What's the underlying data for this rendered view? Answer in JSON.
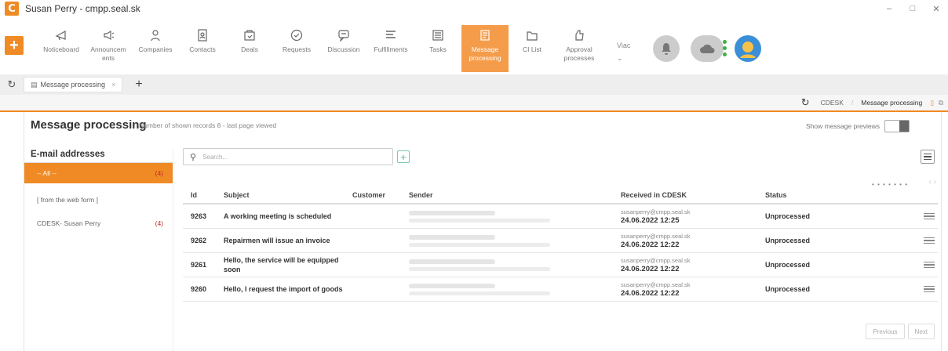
{
  "window": {
    "title": "Susan Perry - cmpp.seal.sk",
    "logo_letter": "C",
    "controls": [
      "–",
      "□",
      "✕"
    ]
  },
  "ribbon": {
    "add_label": "+",
    "items": [
      {
        "label": "Noticeboard",
        "icon": "megaphone-icon"
      },
      {
        "label": "Announcem ents",
        "icon": "announce-icon"
      },
      {
        "label": "Companies",
        "icon": "person-icon"
      },
      {
        "label": "Contacts",
        "icon": "contacts-icon"
      },
      {
        "label": "Deals",
        "icon": "deal-icon"
      },
      {
        "label": "Requests",
        "icon": "check-circle-icon"
      },
      {
        "label": "Discussion",
        "icon": "chat-icon"
      },
      {
        "label": "Fulfillments",
        "icon": "lines-icon"
      },
      {
        "label": "Tasks",
        "icon": "tasks-icon"
      },
      {
        "label": "Message processing",
        "icon": "message-processing-icon",
        "active": true
      },
      {
        "label": "CI List",
        "icon": "folder-icon"
      },
      {
        "label": "Approval processes",
        "icon": "approval-icon"
      }
    ],
    "lang_label": "Viac",
    "lang_arrow": "⌄"
  },
  "tabs": {
    "refresh": "↻",
    "items": [
      {
        "label": "Message processing",
        "close": "×"
      }
    ],
    "add": "+"
  },
  "breadcrumb": {
    "refresh": "↻",
    "root": "CDESK",
    "current": "Message processing"
  },
  "page": {
    "title": "Message processing",
    "subtitle": "Number of shown records 8 - last page viewed",
    "preview_label": "Show message previews"
  },
  "email_panel": {
    "heading": "E-mail addresses",
    "items": [
      {
        "label": "-- All --",
        "count": "(4)",
        "active": true
      },
      {
        "label": "[ from the web form ]",
        "count": ""
      },
      {
        "label": "CDESK- Susan Perry",
        "count": "(4)"
      }
    ]
  },
  "search": {
    "placeholder": "Search...",
    "add": "+"
  },
  "pager": {
    "dots": "• • • • • • •",
    "arrows": "‹ ›",
    "previous": "Previous",
    "next": "Next"
  },
  "table": {
    "headers": {
      "id": "Id",
      "subject": "Subject",
      "customer": "Customer",
      "sender": "Sender",
      "received": "Received in CDESK",
      "status": "Status"
    },
    "rows": [
      {
        "id": "9263",
        "subject": "A working meeting is scheduled",
        "customer": "",
        "email": "susanperry@cmpp.seal.sk",
        "date": "24.06.2022 12:25",
        "status": "Unprocessed"
      },
      {
        "id": "9262",
        "subject": "Repairmen will issue an invoice",
        "customer": "",
        "email": "susanperry@cmpp.seal.sk",
        "date": "24.06.2022 12:22",
        "status": "Unprocessed"
      },
      {
        "id": "9261",
        "subject": "Hello, the service will be equipped soon",
        "customer": "",
        "email": "susanperry@cmpp.seal.sk",
        "date": "24.06.2022 12:22",
        "status": "Unprocessed"
      },
      {
        "id": "9260",
        "subject": "Hello, I request the import of goods",
        "customer": "",
        "email": "susanperry@cmpp.seal.sk",
        "date": "24.06.2022 12:22",
        "status": "Unprocessed"
      }
    ]
  },
  "colors": {
    "accent": "#f08a24",
    "active_tab": "#f59c4b",
    "count_red": "#c1272d",
    "online_green": "#3cb043"
  }
}
